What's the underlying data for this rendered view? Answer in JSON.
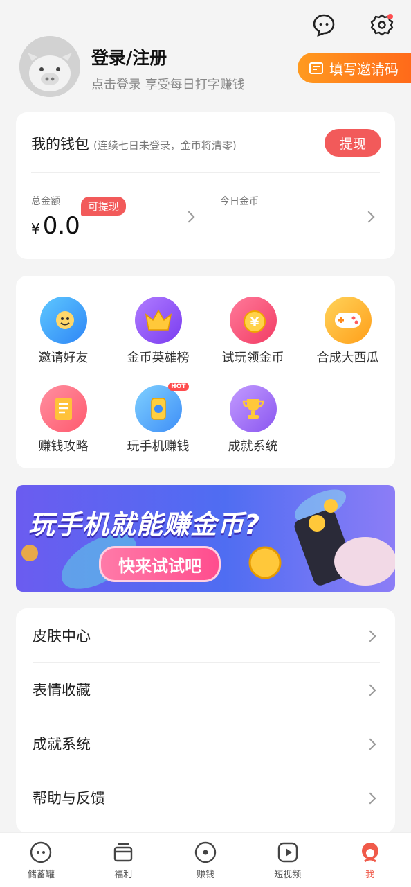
{
  "header": {
    "title": "登录/注册",
    "subtitle": "点击登录 享受每日打字赚钱",
    "invite_label": "填写邀请码",
    "chat_icon": "chat-bubble-icon",
    "settings_icon": "settings-gear-icon"
  },
  "wallet": {
    "title": "我的钱包",
    "note": "(连续七日未登录，金币将清零)",
    "withdraw_label": "提现",
    "total_label": "总金额",
    "currency": "¥",
    "total_value": "0.0",
    "badge": "可提现",
    "coins_label": "今日金币"
  },
  "grid": [
    {
      "label": "邀请好友",
      "icon": "invite-friends-icon"
    },
    {
      "label": "金币英雄榜",
      "icon": "crown-icon"
    },
    {
      "label": "试玩领金币",
      "icon": "yen-coin-icon"
    },
    {
      "label": "合成大西瓜",
      "icon": "gamepad-icon"
    },
    {
      "label": "赚钱攻略",
      "icon": "document-icon"
    },
    {
      "label": "玩手机赚钱",
      "icon": "phone-coin-icon"
    },
    {
      "label": "成就系统",
      "icon": "trophy-icon"
    }
  ],
  "grid_hot_badge": "HOT",
  "banner": {
    "title": "玩手机就能赚金币?",
    "button": "快来试试吧"
  },
  "menu": [
    {
      "label": "皮肤中心"
    },
    {
      "label": "表情收藏"
    },
    {
      "label": "成就系统"
    },
    {
      "label": "帮助与反馈"
    }
  ],
  "tabs": [
    {
      "label": "储蓄罐",
      "icon": "piggy-face-icon"
    },
    {
      "label": "福利",
      "icon": "gift-box-icon"
    },
    {
      "label": "赚钱",
      "icon": "coin-circle-icon"
    },
    {
      "label": "短视频",
      "icon": "play-video-icon"
    },
    {
      "label": "我",
      "icon": "profile-icon",
      "active": true
    }
  ],
  "colors": {
    "accent": "#f25a5a",
    "invite_orange": "#ff7a1a",
    "tab_active": "#f05a4a"
  }
}
